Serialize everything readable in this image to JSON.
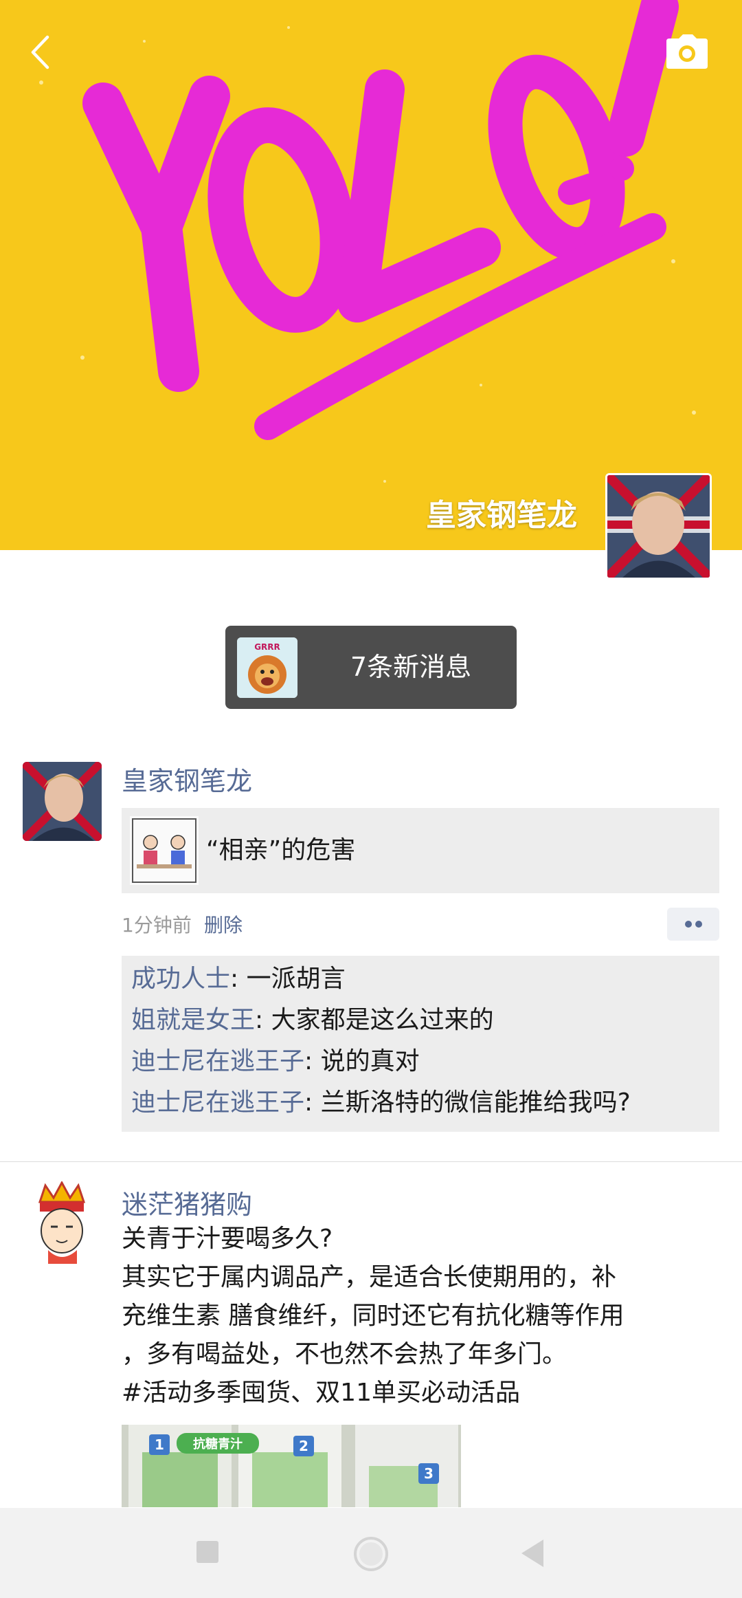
{
  "cover": {
    "artwork_text": "YOLO!",
    "owner_name": "皇家钢笔龙",
    "back_icon": "chevron-left-icon",
    "camera_icon": "camera-icon",
    "colors": {
      "background": "#f7c81b",
      "lettering": "#e62ad6"
    }
  },
  "notification": {
    "text": "7条新消息",
    "avatar_badge": "GRRR"
  },
  "posts": [
    {
      "author": "皇家钢笔龙",
      "shared_link": {
        "title": "“相亲”的危害"
      },
      "time": "1分钟前",
      "delete_label": "删除",
      "comments": [
        {
          "user": "成功人士",
          "text": ": 一派胡言"
        },
        {
          "user": "姐就是女王",
          "text": ": 大家都是这么过来的"
        },
        {
          "user": "迪士尼在逃王子",
          "text": ": 说的真对"
        },
        {
          "user": "迪士尼在逃王子",
          "text": ": 兰斯洛特的微信能推给我吗?"
        }
      ]
    },
    {
      "author": "迷茫猪猪购",
      "lines": [
        "关青于汁要喝多久?",
        "其实它于属内调品产，是适合长使期用的，补",
        "充维生素 膳食维纤，同时还它有抗化糖等作用",
        "，多有喝益处，不也然不会热了年多门。",
        "#活动多季囤货、双11单买必动活品"
      ],
      "image": {
        "label": "抗糖青汁",
        "numbers": [
          "1",
          "2",
          "3"
        ]
      }
    }
  ],
  "navbar": {
    "icons": [
      "recent-apps-icon",
      "home-icon",
      "back-triangle-icon"
    ]
  },
  "accent_color": "#576b95"
}
